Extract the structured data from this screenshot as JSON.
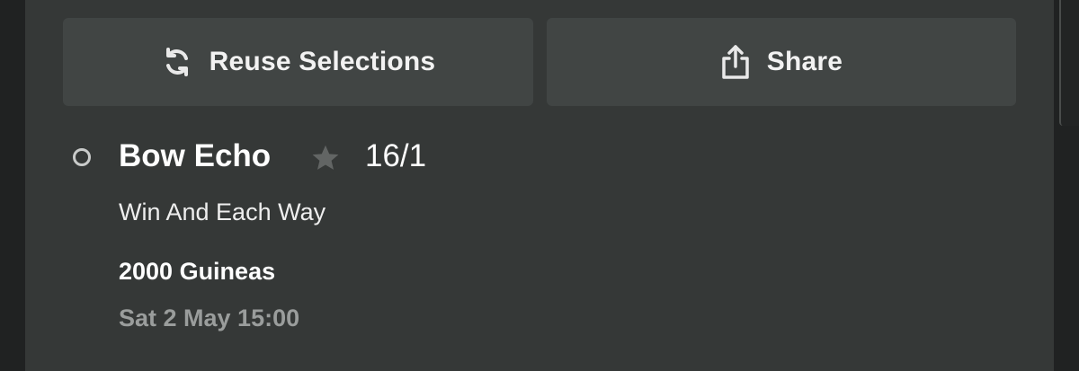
{
  "buttons": {
    "reuse_label": "Reuse Selections",
    "reuse_icon": "refresh-icon",
    "share_label": "Share",
    "share_icon": "share-icon"
  },
  "selection": {
    "name": "Bow Echo",
    "favourite_icon": "star-icon",
    "odds": "16/1",
    "market": "Win And Each Way",
    "event": "2000 Guineas",
    "datetime": "Sat 2 May 15:00"
  },
  "colors": {
    "background": "#353837",
    "button": "#414544",
    "text": "#ffffff",
    "muted_text": "#9a9d9c"
  }
}
